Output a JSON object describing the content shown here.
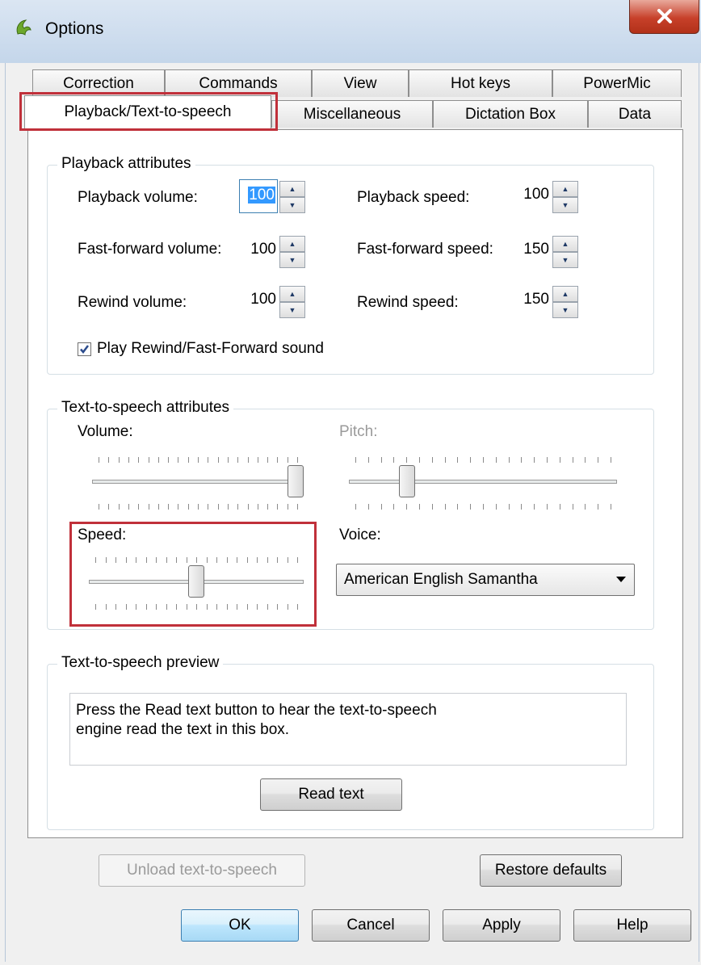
{
  "window": {
    "title": "Options",
    "title_icon": "dragon-icon",
    "close_glyph": "X"
  },
  "tabs": {
    "row1": [
      "Correction",
      "Commands",
      "View",
      "Hot keys",
      "PowerMic"
    ],
    "row2": [
      "Playback/Text-to-speech",
      "Miscellaneous",
      "Dictation Box",
      "Data"
    ],
    "active": "Playback/Text-to-speech"
  },
  "playback": {
    "group_label": "Playback attributes",
    "volume_label": "Playback volume:",
    "volume_value": "100",
    "speed_label": "Playback speed:",
    "speed_value": "100",
    "ff_volume_label": "Fast-forward volume:",
    "ff_volume_value": "100",
    "ff_speed_label": "Fast-forward speed:",
    "ff_speed_value": "150",
    "rewind_volume_label": "Rewind volume:",
    "rewind_volume_value": "100",
    "rewind_speed_label": "Rewind speed:",
    "rewind_speed_value": "150",
    "sound_checkbox_label": "Play Rewind/Fast-Forward sound",
    "sound_checked": true
  },
  "tts": {
    "group_label": "Text-to-speech attributes",
    "volume_label": "Volume:",
    "volume_level": 1.0,
    "pitch_label": "Pitch:",
    "pitch_level": 0.2,
    "pitch_enabled": false,
    "speed_label": "Speed:",
    "speed_level": 0.5,
    "voice_label": "Voice:",
    "voice_value": "American English Samantha"
  },
  "preview": {
    "group_label": "Text-to-speech preview",
    "text_line1": "Press the Read text button to hear the text-to-speech",
    "text_line2": "engine read the text in this box.",
    "read_button": "Read text"
  },
  "panel_buttons": {
    "unload": "Unload text-to-speech",
    "restore": "Restore defaults"
  },
  "dialog_buttons": {
    "ok": "OK",
    "cancel": "Cancel",
    "apply": "Apply",
    "help": "Help"
  },
  "colors": {
    "highlight": "#c0303a",
    "selection": "#3399ff",
    "close": "#c7402a"
  }
}
